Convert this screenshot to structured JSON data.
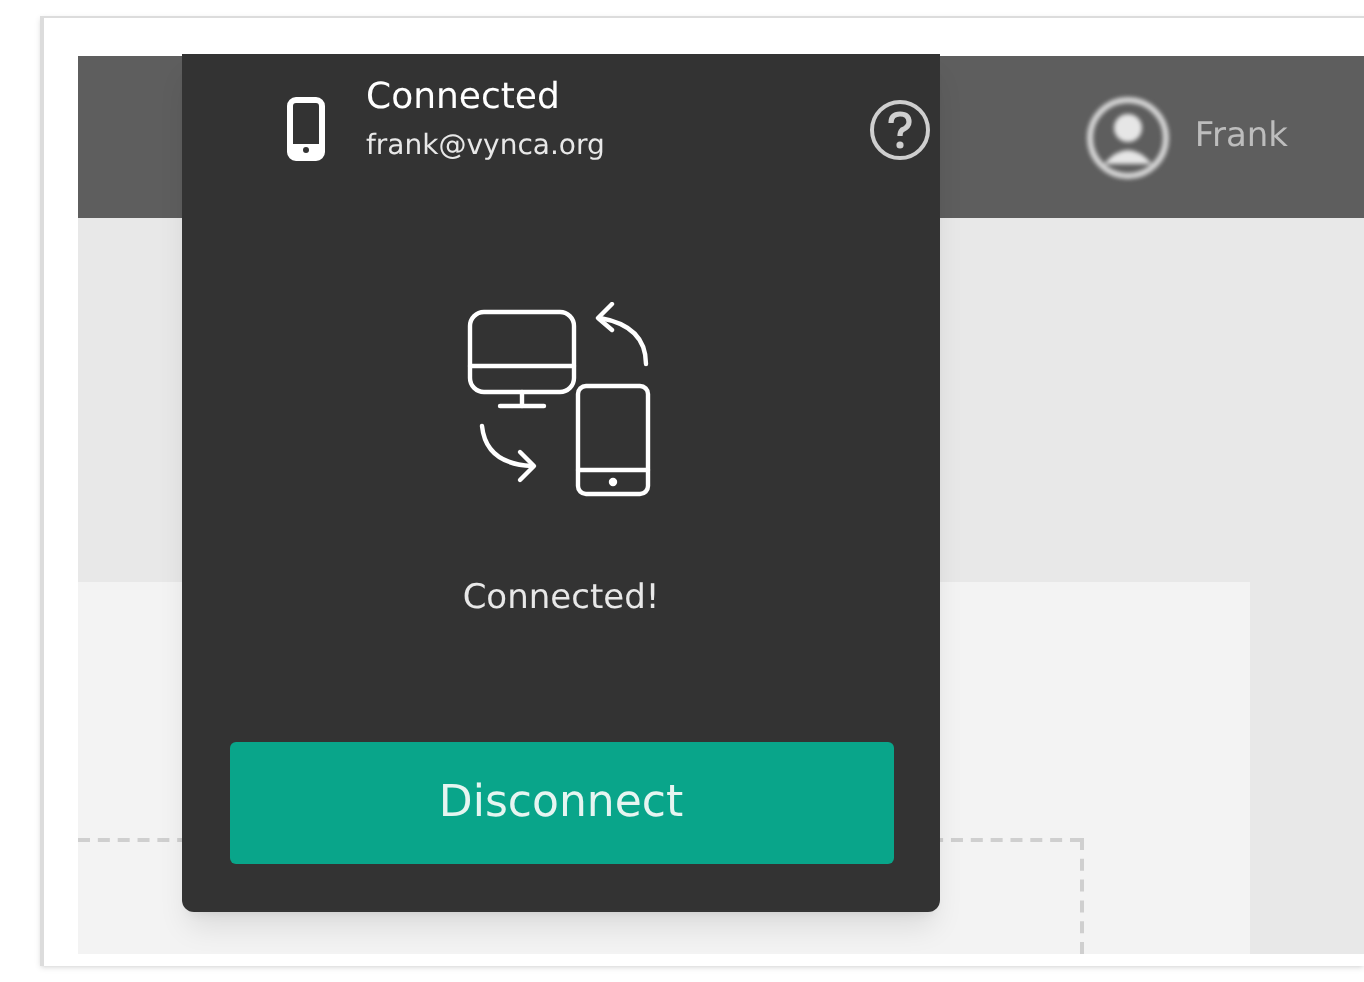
{
  "header": {
    "user_name": "Frank"
  },
  "popup": {
    "status": "Connected",
    "account": "frank@vynca.org",
    "message": "Connected!",
    "button": "Disconnect"
  }
}
